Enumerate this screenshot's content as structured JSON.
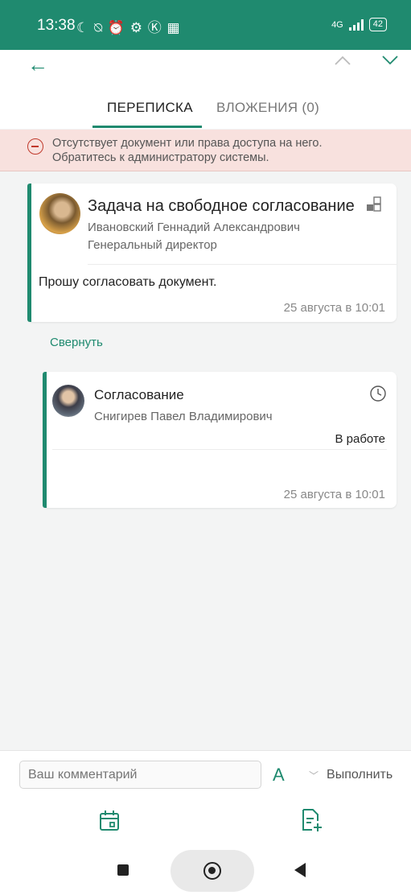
{
  "status_bar": {
    "time": "13:38",
    "icons_text": "☾ ⍉ ⏰ ⚙ Ⓚ ▦",
    "network": "4G",
    "battery": "42"
  },
  "toolbar": {
    "back_icon": "back-arrow-icon",
    "up_icon": "chevron-up-icon",
    "down_icon": "chevron-down-icon"
  },
  "tabs": [
    {
      "label": "ПЕРЕПИСКА",
      "active": true
    },
    {
      "label": "ВЛОЖЕНИЯ (0)",
      "active": false
    }
  ],
  "alert": {
    "line1": "Отсутствует документ или права доступа на него.",
    "line2": "Обратитесь к администратору системы."
  },
  "task_card": {
    "title": "Задача на свободное согласование",
    "author": "Ивановский Геннадий Александрович",
    "position": "Генеральный директор",
    "message": "Прошу согласовать документ.",
    "date": "25 августа в 10:01"
  },
  "collapse_link": "Свернуть",
  "approval_card": {
    "title": "Согласование",
    "author": "Снигирев Павел Владимирович",
    "status": "В работе",
    "date": "25 августа в 10:01"
  },
  "comment_bar": {
    "placeholder": "Ваш комментарий",
    "font_button": "A",
    "action": "Выполнить"
  },
  "colors": {
    "accent": "#1f8a6f",
    "alert_bg": "#f8e1de",
    "alert_icon": "#c0392b"
  }
}
